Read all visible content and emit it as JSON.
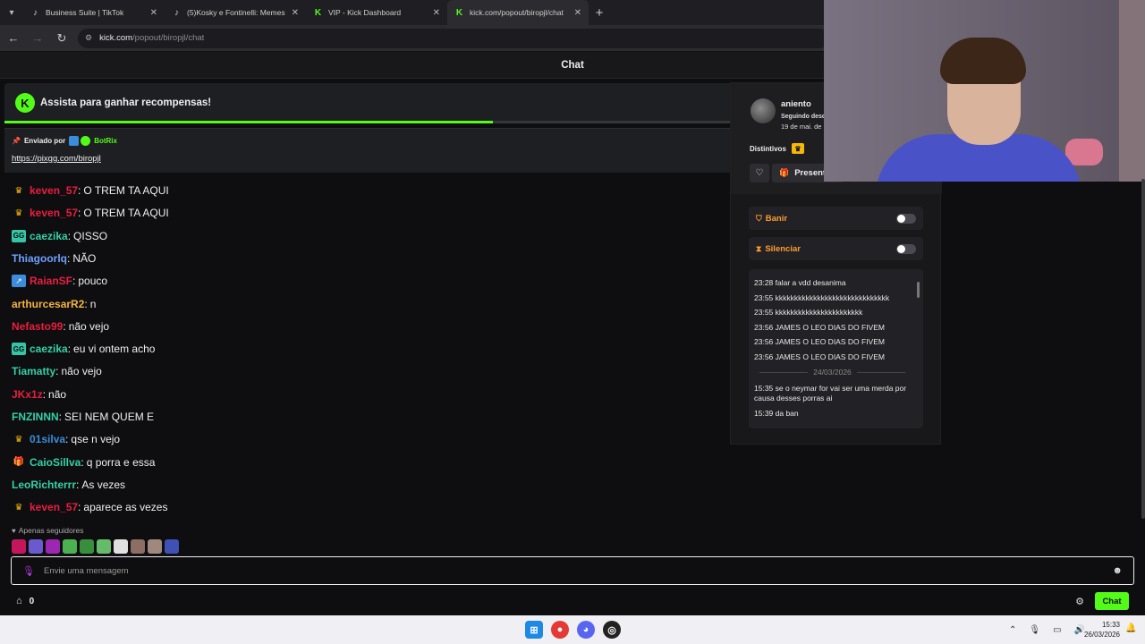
{
  "browser": {
    "tabs": [
      {
        "title": "Business Suite | TikTok",
        "icon": "tiktok-icon",
        "active": false
      },
      {
        "title": "(5)Kosky e Fontinelli: Memes e I",
        "icon": "tiktok-icon",
        "active": false
      },
      {
        "title": "VIP - Kick Dashboard",
        "icon": "kick-icon",
        "active": false
      },
      {
        "title": "kick.com/popout/biropjl/chat",
        "icon": "kick-icon",
        "active": true
      }
    ],
    "url_host": "kick.com",
    "url_path": "/popout/biropjl/chat"
  },
  "chat": {
    "header_title": "Chat",
    "reward_banner": {
      "text": "Assista para ganhar recompensas!",
      "progress": 0.67
    },
    "pinned": {
      "prefix": "Enviado por",
      "sender": "BotRix",
      "link": "https://pixgg.com/biropjl"
    },
    "messages": [
      {
        "badge": "crown",
        "user": "keven_57",
        "color": "#e91e3f",
        "text": "O TREM TA AQUI"
      },
      {
        "badge": "crown",
        "user": "keven_57",
        "color": "#e91e3f",
        "text": "O TREM TA AQUI"
      },
      {
        "badge": "gg",
        "user": "caezika",
        "color": "#35d0a7",
        "text": "QISSO"
      },
      {
        "badge": "",
        "user": "Thiagoorlq",
        "color": "#6fa0ff",
        "text": "NÃO"
      },
      {
        "badge": "sub",
        "user": "RaianSF",
        "color": "#e91e3f",
        "text": "pouco"
      },
      {
        "badge": "",
        "user": "arthurcesarR2",
        "color": "#f5b341",
        "text": "n"
      },
      {
        "badge": "",
        "user": "Nefasto99",
        "color": "#e91e3f",
        "text": "não vejo"
      },
      {
        "badge": "gg",
        "user": "caezika",
        "color": "#35d0a7",
        "text": "eu vi ontem acho"
      },
      {
        "badge": "",
        "user": "Tiamatty",
        "color": "#35d0a7",
        "text": "não vejo"
      },
      {
        "badge": "",
        "user": "JKx1z",
        "color": "#e91e3f",
        "text": "não"
      },
      {
        "badge": "",
        "user": "FNZINNN",
        "color": "#35d0a7",
        "text": "SEI NEM QUEM E"
      },
      {
        "badge": "crown",
        "user": "01silva",
        "color": "#3b8ddb",
        "text": "qse n vejo"
      },
      {
        "badge": "gift",
        "user": "CaioSillva",
        "color": "#35d0a7",
        "text": "q porra e essa"
      },
      {
        "badge": "",
        "user": "LeoRichterrr",
        "color": "#35d0a7",
        "text": "As vezes"
      },
      {
        "badge": "crown",
        "user": "keven_57",
        "color": "#e91e3f",
        "text": "aparece as vezes"
      }
    ],
    "followers_only": "Apenas seguidores",
    "input_placeholder": "Envie uma mensagem",
    "kicks_count": "0",
    "send_label": "Chat"
  },
  "usercard": {
    "username": "aniento",
    "following_label": "Seguindo desde",
    "following_date": "19 de mai. de",
    "badges_label": "Distintivos",
    "gift_label": "Presente",
    "ban_label": "Banir",
    "timeout_label": "Silenciar",
    "history": [
      {
        "time": "23:28",
        "text": "falar a vdd desanima"
      },
      {
        "time": "23:55",
        "text": "kkkkkkkkkkkkkkkkkkkkkkkkkkkkkk"
      },
      {
        "time": "23:55",
        "text": "kkkkkkkkkkkkkkkkkkkkkkk"
      },
      {
        "time": "23:56",
        "text": "JAMES O LEO DIAS DO FIVEM"
      },
      {
        "time": "23:56",
        "text": "JAMES O LEO DIAS DO FIVEM"
      },
      {
        "time": "23:56",
        "text": "JAMES O LEO DIAS DO FIVEM"
      }
    ],
    "history_date": "24/03/2026",
    "history_after": [
      {
        "time": "15:35",
        "text": "se o neymar for vai ser uma merda por causa desses porras ai"
      },
      {
        "time": "15:39",
        "text": "da ban"
      }
    ]
  },
  "taskbar": {
    "time": "15:33",
    "date": "26/03/2026"
  },
  "colors": {
    "kick_green": "#53fc18",
    "background": "#0e0e10",
    "panel": "#18181b"
  }
}
